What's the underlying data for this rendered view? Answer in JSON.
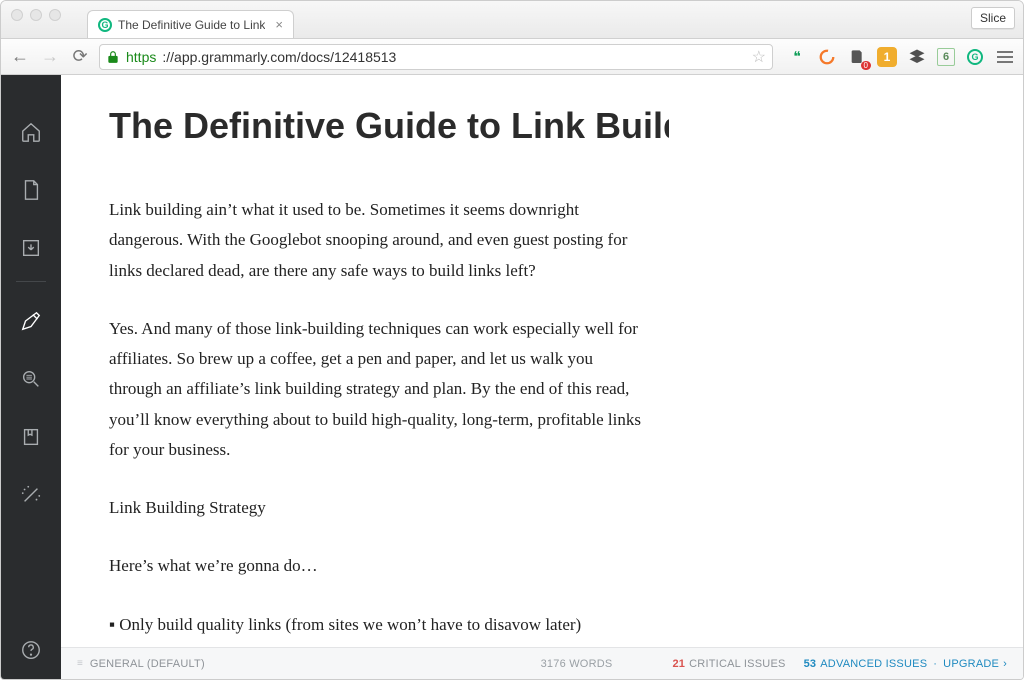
{
  "browser": {
    "tab_title": "The Definitive Guide to Link",
    "slice_label": "Slice",
    "url_scheme": "https",
    "url_rest": "://app.grammarly.com/docs/12418513",
    "extensions": {
      "hangouts": "hangouts-icon",
      "circle": "circle-orange-icon",
      "cart": "evernote-clipper-icon",
      "badge1_value": "1",
      "buffer": "buffer-icon",
      "six": "6",
      "grammarly": "grammarly-icon"
    }
  },
  "document": {
    "title": "The Definitive Guide to Link Buildi…",
    "paragraphs": [
      "Link building ain’t what it used to be. Sometimes it seems downright dangerous. With the Googlebot snooping around, and even guest posting for links declared dead, are there any safe ways to build links left?",
      "Yes. And many of those link-building techniques can work especially well for affiliates. So brew up a coffee, get a pen and paper, and let us walk you through an affiliate’s link building strategy and plan. By the end of this read, you’ll know everything about to build high-quality, long-term, profitable links for your business.",
      "Link Building Strategy",
      "Here’s what we’re gonna do…"
    ],
    "bullet": "Only build quality links (from sites we won’t have to disavow later)"
  },
  "footer": {
    "profile": "GENERAL (DEFAULT)",
    "word_count": "3176 WORDS",
    "critical_count": "21",
    "critical_label": "CRITICAL ISSUES",
    "advanced_count": "53",
    "advanced_label": "ADVANCED ISSUES",
    "upgrade": "UPGRADE",
    "chevron": "›"
  },
  "sidebar": {
    "items": [
      "home",
      "new-doc",
      "download",
      "pen",
      "search",
      "bookmark",
      "wand",
      "help"
    ]
  }
}
